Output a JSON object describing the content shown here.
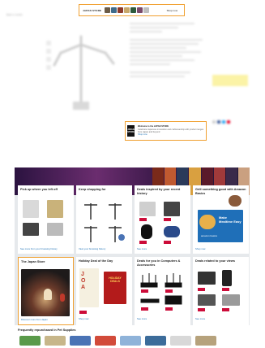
{
  "product_page": {
    "top_banner": {
      "brand": "JAPAN STORE",
      "link": "Shop now",
      "tile_colors": [
        "#6b5b47",
        "#3f6b8a",
        "#8c3a2c",
        "#c8a86b",
        "#2e5a3b",
        "#7a4a6a",
        "#bfbfbf"
      ]
    },
    "breadcrumb": "Back to results",
    "mini_banner": {
      "logo_line1": "JAPAN",
      "logo_line2": "STORE",
      "text": "Welcome to the JAPAN STORE",
      "subtext": "Celebrate Japanese innovation and craftsmanship with product ranges from Japan and beyond",
      "link": "Shop now"
    },
    "share_icon_colors": [
      "#cfcfcf",
      "#3b5998",
      "#1da1f2",
      "#e60023"
    ]
  },
  "home_page": {
    "cards": [
      {
        "title": "Pick up where you left off",
        "more": "See more from your browsing history"
      },
      {
        "title": "Keep shopping for",
        "more": "View your browsing history"
      },
      {
        "title": "Deals inspired by your recent history",
        "more": "See more"
      },
      {
        "title": "Grill something good with Amazon Basics",
        "more": "Shop now",
        "promo": "Make Mealtime Easy",
        "promo_brand": "amazon basics"
      },
      {
        "title": "The Japan Store",
        "more": "Discover more from Japan"
      },
      {
        "title": "Holiday Deal of the Day",
        "more": "Shop now",
        "promo": "HOLIDAY DEALS"
      },
      {
        "title": "Deals for you in Computers & Accessories",
        "more": "See more"
      },
      {
        "title": "Deals related to your views",
        "more": "See more"
      }
    ],
    "frequently": {
      "title": "Frequently repurchased in Pet Supplies",
      "tile_colors": [
        "#5a9a4a",
        "#c7b68a",
        "#4a73b5",
        "#d24b3a",
        "#8fb3d9",
        "#3c6c9a",
        "#d8d8d8",
        "#b6a27c"
      ]
    }
  }
}
